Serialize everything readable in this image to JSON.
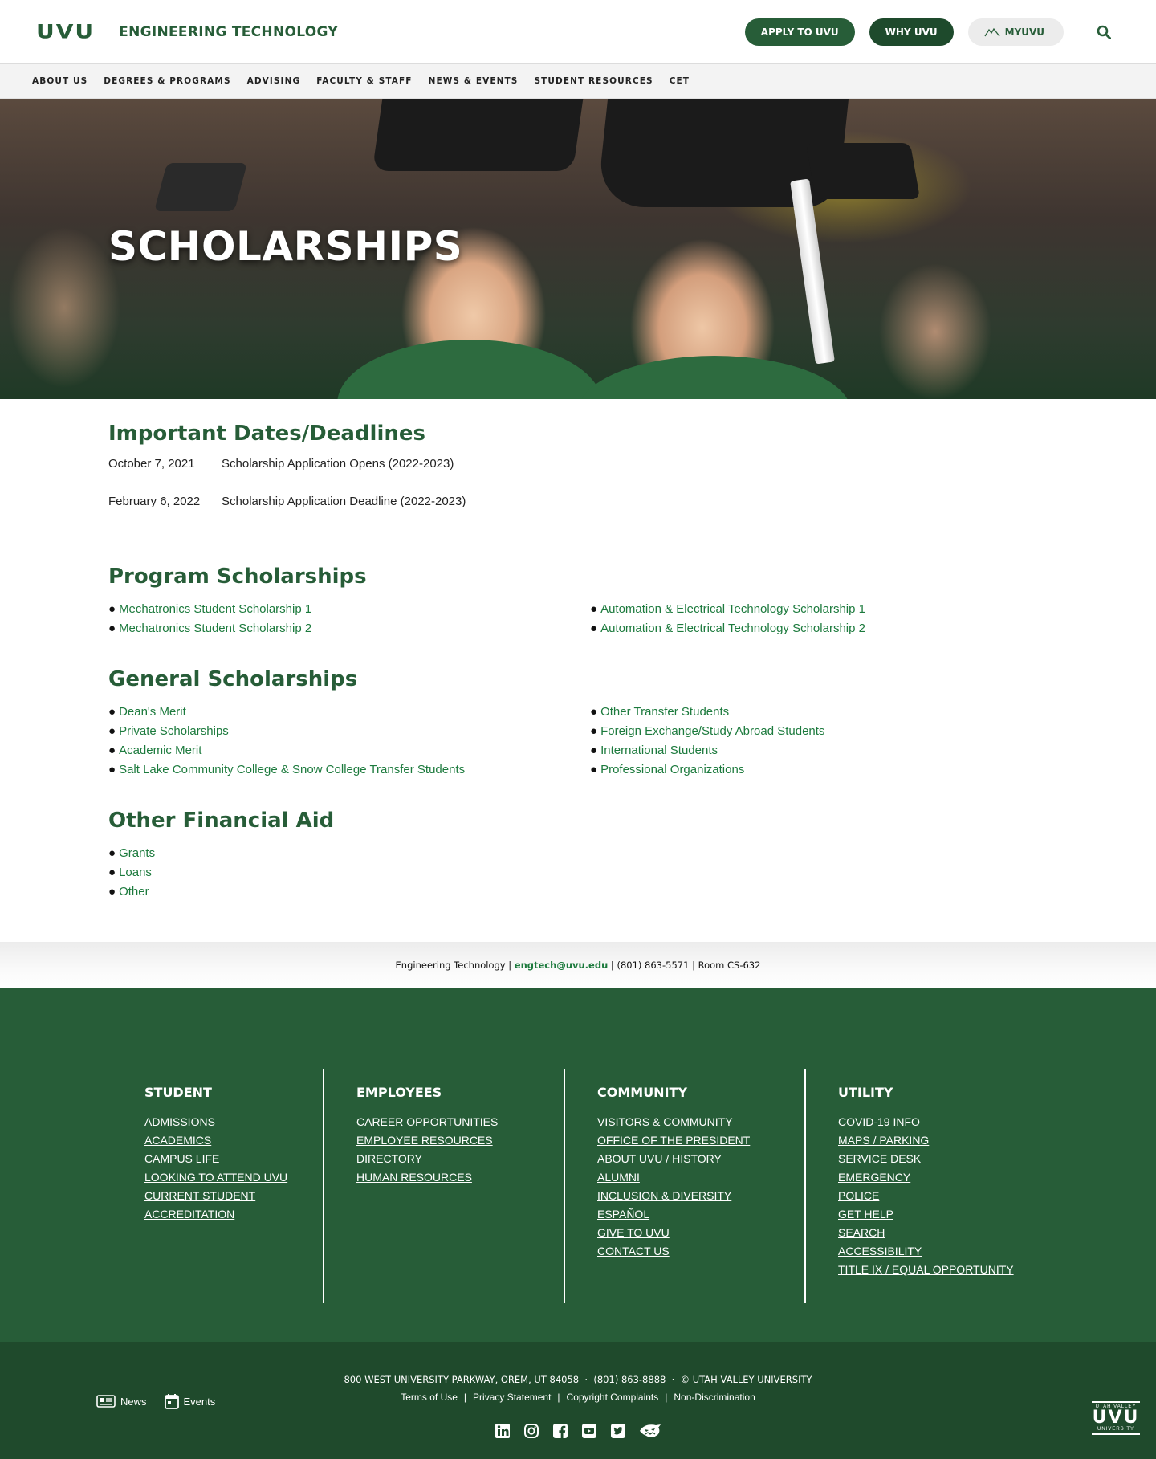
{
  "header": {
    "logo": "UVU",
    "dept": "ENGINEERING TECHNOLOGY",
    "apply": "APPLY TO UVU",
    "why": "WHY UVU",
    "myuvu": "MYUVU"
  },
  "nav": [
    "ABOUT US",
    "DEGREES & PROGRAMS",
    "ADVISING",
    "FACULTY & STAFF",
    "NEWS & EVENTS",
    "STUDENT RESOURCES",
    "CET"
  ],
  "hero": {
    "title": "SCHOLARSHIPS"
  },
  "dates": {
    "title": "Important Dates/Deadlines",
    "rows": [
      {
        "date": "October 7, 2021",
        "event": "Scholarship Application Opens (2022-2023)"
      },
      {
        "date": "February 6, 2022",
        "event": "Scholarship Application Deadline (2022-2023)"
      }
    ]
  },
  "program": {
    "title": "Program Scholarships",
    "left": [
      "Mechatronics Student Scholarship 1",
      "Mechatronics Student Scholarship 2"
    ],
    "right": [
      "Automation & Electrical Technology Scholarship 1",
      "Automation & Electrical Technology Scholarship 2"
    ]
  },
  "general": {
    "title": "General Scholarships",
    "left": [
      "Dean's Merit",
      "Private Scholarships",
      "Academic Merit",
      "Salt Lake Community College & Snow College Transfer Students"
    ],
    "right": [
      "Other Transfer Students",
      "Foreign Exchange/Study Abroad Students",
      "International Students",
      "Professional Organizations"
    ]
  },
  "other": {
    "title": "Other Financial Aid",
    "items": [
      "Grants",
      "Loans",
      "Other"
    ]
  },
  "bullet": "●",
  "contact": {
    "dept": "Engineering Technology",
    "sep": " | ",
    "email": "engtech@uvu.edu",
    "phone": "(801) 863-5571",
    "room": "Room CS-632"
  },
  "footer": {
    "student": {
      "title": "STUDENT",
      "links": [
        "ADMISSIONS",
        "ACADEMICS",
        "CAMPUS LIFE",
        "LOOKING TO ATTEND UVU",
        "CURRENT STUDENT",
        "ACCREDITATION"
      ]
    },
    "employees": {
      "title": "EMPLOYEES",
      "links": [
        "CAREER OPPORTUNITIES",
        "EMPLOYEE RESOURCES",
        "DIRECTORY",
        "HUMAN RESOURCES"
      ]
    },
    "community": {
      "title": "COMMUNITY",
      "links": [
        "VISITORS & COMMUNITY",
        "OFFICE OF THE PRESIDENT",
        "ABOUT UVU / HISTORY",
        "ALUMNI",
        "INCLUSION & DIVERSITY",
        "ESPAÑOL",
        "GIVE TO UVU",
        "CONTACT US"
      ]
    },
    "utility": {
      "title": "UTILITY",
      "links": [
        "COVID-19 INFO",
        "MAPS / PARKING",
        "SERVICE DESK",
        "EMERGENCY",
        "POLICE",
        "GET HELP",
        "SEARCH",
        "ACCESSIBILITY",
        "TITLE IX / EQUAL OPPORTUNITY"
      ]
    }
  },
  "bottom": {
    "address": "800 WEST UNIVERSITY PARKWAY, OREM, UT 84058  ·  (801) 863-8888  ·  © UTAH VALLEY UNIVERSITY",
    "legal": [
      "Terms of Use",
      "Privacy Statement",
      "Copyright Complaints",
      "Non-Discrimination"
    ],
    "legal_sep": "|",
    "news": "News",
    "events": "Events",
    "seal_top": "UTAH VALLEY",
    "seal_mid": "UVU",
    "seal_bottom": "UNIVERSITY",
    "socials": [
      "linkedin-icon",
      "instagram-icon",
      "facebook-icon",
      "youtube-icon",
      "twitter-icon",
      "wolverine-icon"
    ]
  },
  "colors": {
    "primary": "#275d38",
    "link": "#1c7a3d",
    "footer": "#275d38",
    "footer_dark": "#1f4a2c"
  }
}
